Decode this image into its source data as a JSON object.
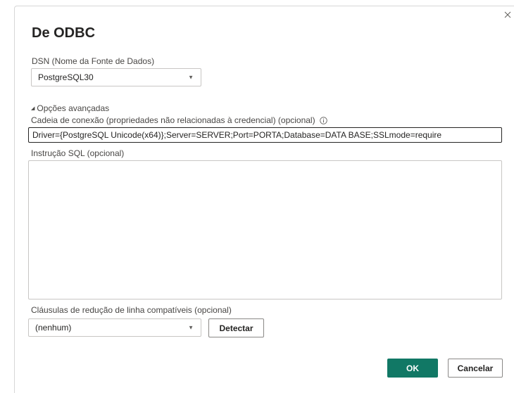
{
  "dialog": {
    "title": "De ODBC",
    "close_label": "×"
  },
  "dsn": {
    "label": "DSN (Nome da Fonte de Dados)",
    "value": "PostgreSQL30"
  },
  "advanced": {
    "toggle_label": "Opções avançadas",
    "connection_string": {
      "label": "Cadeia de conexão (propriedades não relacionadas à credencial) (opcional)",
      "value": "Driver={PostgreSQL Unicode(x64)};Server=SERVER;Port=PORTA;Database=DATA BASE;SSLmode=require"
    },
    "sql_statement": {
      "label": "Instrução SQL (opcional)",
      "value": ""
    },
    "row_reduction": {
      "label": "Cláusulas de redução de linha compatíveis (opcional)",
      "value": "(nenhum)",
      "detect_label": "Detectar"
    }
  },
  "footer": {
    "ok_label": "OK",
    "cancel_label": "Cancelar"
  },
  "colors": {
    "primary": "#117865",
    "text": "#252423",
    "border": "#c8c6c4"
  }
}
